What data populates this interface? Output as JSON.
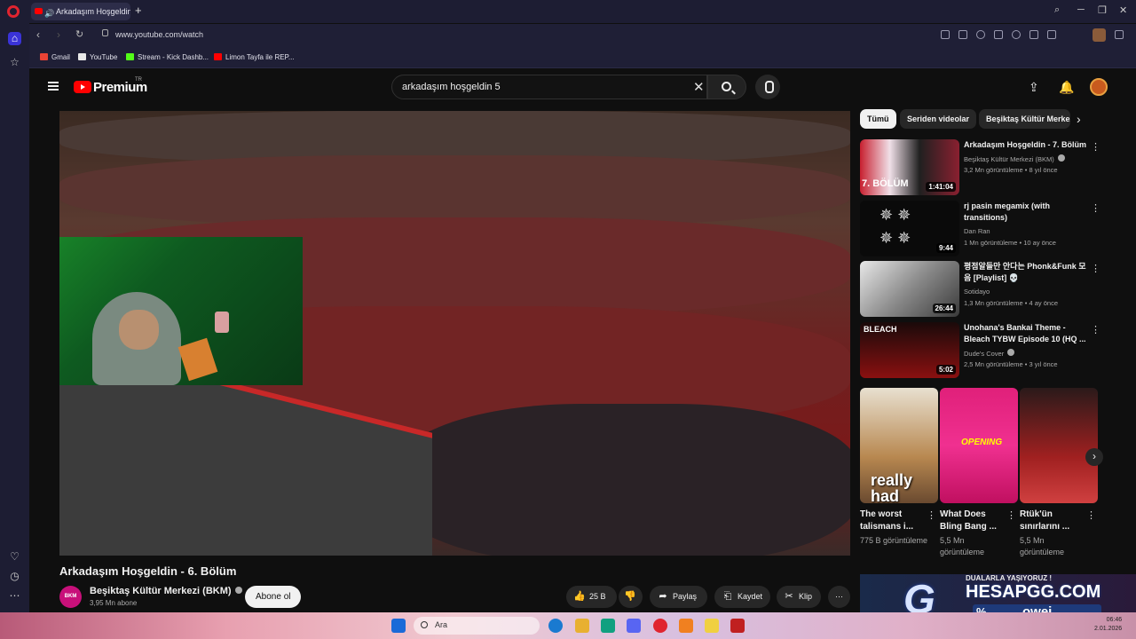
{
  "browser": {
    "tab_title": "Arkadaşım Hoşgeldin",
    "url": "www.youtube.com/watch",
    "ai_label": "AI",
    "bookmarks": [
      {
        "label": "Gmail",
        "color": "#ea4335"
      },
      {
        "label": "YouTube",
        "color": "#e8e8e8"
      },
      {
        "label": "Stream - Kick Dashb...",
        "color": "#53fc18"
      },
      {
        "label": "Limon Tayfa ile REP...",
        "color": "#ff0000"
      }
    ]
  },
  "youtube": {
    "logo_text": "Premium",
    "region": "TR",
    "search_value": "arkadaşım hoşgeldin 5",
    "video": {
      "title": "Arkadaşım Hoşgeldin - 6. Bölüm",
      "channel": "Beşiktaş Kültür Merkezi (BKM)",
      "channel_avatar": "BKM",
      "subscribers": "3,95 Mn abone",
      "subscribe_label": "Abone ol",
      "likes": "25 B",
      "share_label": "Paylaş",
      "save_label": "Kaydet",
      "clip_label": "Klip"
    },
    "chips": [
      "Tümü",
      "Seriden videolar",
      "Beşiktaş Kültür Merkezi"
    ],
    "recommendations": [
      {
        "title": "Arkadaşım Hoşgeldin - 7. Bölüm",
        "channel": "Beşiktaş Kültür Merkezi (BKM)",
        "meta": "3,2 Mn görüntüleme • 8 yıl önce",
        "duration": "1:41:04",
        "thumb_text": "7. BÖLÜM"
      },
      {
        "title": "rj pasin megamix (with transitions)",
        "channel": "Dan Ran",
        "meta": "1 Mn görüntüleme • 10 ay önce",
        "duration": "9:44",
        "thumb_text": ""
      },
      {
        "title": "평점알들만 안다는 Phonk&Funk 모음 [Playlist] 💀",
        "channel": "Sotidayo",
        "meta": "1,3 Mn görüntüleme • 4 ay önce",
        "duration": "26:44",
        "thumb_text": ""
      },
      {
        "title": "Unohana's Bankai Theme - Bleach TYBW Episode 10 (HQ ...",
        "channel": "Dude's Cover",
        "meta": "2,5 Mn görüntüleme • 3 yıl önce",
        "duration": "5:02",
        "thumb_text": "BLEACH"
      }
    ],
    "shorts": [
      {
        "title": "The worst talismans i...",
        "views": "775 B görüntüleme",
        "thumb_text": "really had"
      },
      {
        "title": "What Does Bling Bang ...",
        "views": "5,5 Mn görüntüleme",
        "thumb_text": "OPENING"
      },
      {
        "title": "Rtük'ün sınırlarını ...",
        "views": "5,5 Mn görüntüleme",
        "thumb_text": ""
      }
    ]
  },
  "overlay": {
    "top_text": "DUALARLA YAŞIYORUZ !",
    "brand": "HESAPGG.COM",
    "percent": "%",
    "code": "owei"
  },
  "taskbar": {
    "search_placeholder": "Ara",
    "time": "06:46",
    "date": "2.01.2026"
  }
}
